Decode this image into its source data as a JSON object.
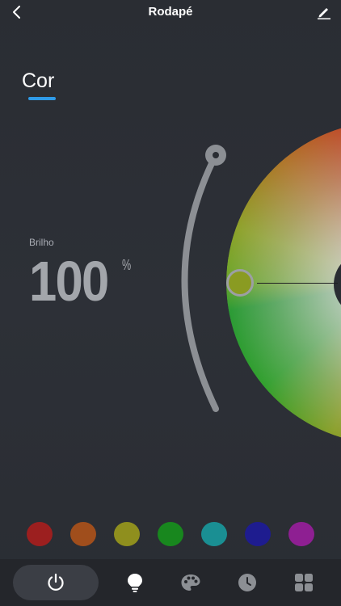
{
  "header": {
    "title": "Rodapé",
    "back_icon": "chevron-left-icon",
    "edit_icon": "pencil-icon"
  },
  "mode_tab": {
    "label": "Cor",
    "accent": "#2f9be8"
  },
  "brightness": {
    "label": "Brilho",
    "value": "100",
    "unit": "%"
  },
  "color_wheel": {
    "selected_color": "#8a9b22"
  },
  "presets": [
    {
      "name": "red",
      "color": "#9c1f1f"
    },
    {
      "name": "orange",
      "color": "#a04e1c"
    },
    {
      "name": "olive",
      "color": "#8f8f1e"
    },
    {
      "name": "green",
      "color": "#18871e"
    },
    {
      "name": "teal",
      "color": "#1a8f93"
    },
    {
      "name": "blue",
      "color": "#1e1c8f"
    },
    {
      "name": "purple",
      "color": "#8e1f92"
    }
  ],
  "bottom_nav": [
    {
      "name": "power",
      "icon": "power-icon"
    },
    {
      "name": "bulb",
      "icon": "bulb-icon",
      "active": true
    },
    {
      "name": "palette",
      "icon": "palette-icon"
    },
    {
      "name": "clock",
      "icon": "clock-icon"
    },
    {
      "name": "grid",
      "icon": "grid-icon"
    }
  ]
}
